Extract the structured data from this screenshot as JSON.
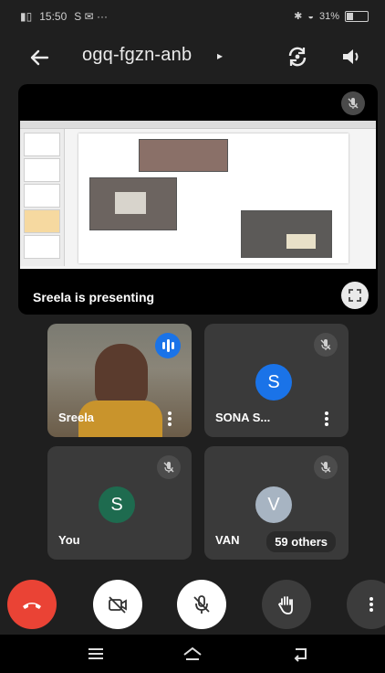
{
  "status_bar": {
    "time": "15:50",
    "notifications": "S ✉ ···",
    "battery_text": "31%",
    "battery_level": 0.31
  },
  "topbar": {
    "meeting_code": "ogq-fgzn-anb",
    "caret": "▸"
  },
  "stage": {
    "presenting_text": "Sreela is presenting"
  },
  "participants": [
    {
      "name": "Sreela"
    },
    {
      "name": "SONA S...",
      "initial": "S",
      "avatar_color": "#1a73e8"
    },
    {
      "name": "You",
      "initial": "S",
      "avatar_color": "#1e6b4f"
    },
    {
      "name": "VAN",
      "initial": "V",
      "avatar_color": "#a7b4c2",
      "others_label": "59 others"
    }
  ],
  "colors": {
    "end_call": "#ea4335",
    "speaking": "#1a73e8",
    "background": "#1f1f1f"
  }
}
